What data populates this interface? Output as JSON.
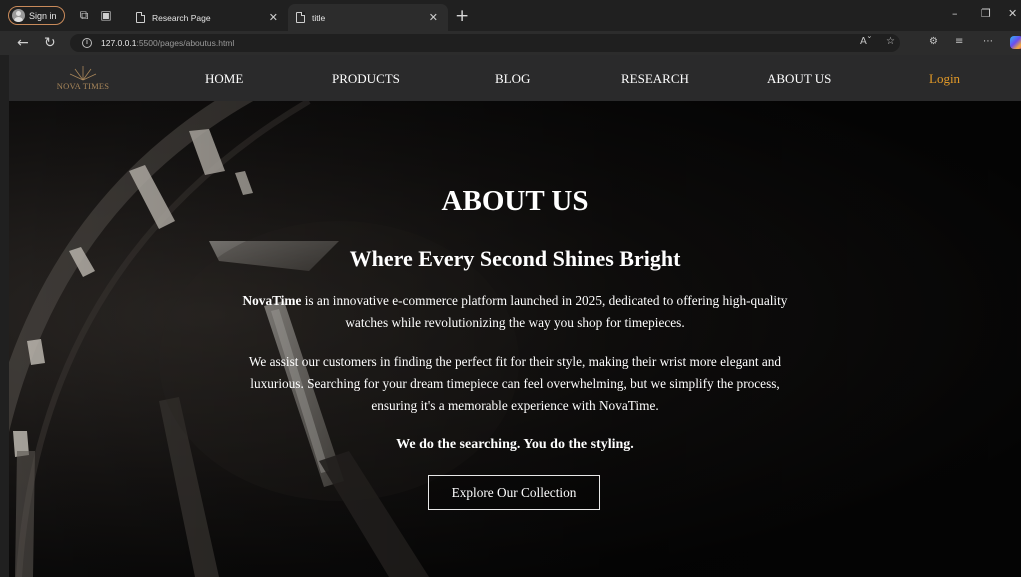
{
  "browser": {
    "signin_label": "Sign in",
    "tabs": [
      {
        "title": "Research Page"
      },
      {
        "title": "title"
      }
    ],
    "url_host": "127.0.0.1",
    "url_path": ":5500/pages/aboutus.html"
  },
  "site": {
    "logo_text": "NOVA TIMES",
    "nav": {
      "home": "HOME",
      "products": "PRODUCTS",
      "blog": "BLOG",
      "research": "RESEARCH",
      "about": "ABOUT US",
      "login": "Login"
    },
    "accent_color": "#e39a28"
  },
  "hero": {
    "title": "ABOUT US",
    "subtitle": "Where Every Second Shines Bright",
    "p1_brand": "NovaTime",
    "p1_rest": " is an innovative e-commerce platform launched in 2025, dedicated to offering high-quality watches while revolutionizing the way you shop for timepieces.",
    "p2": "We assist our customers in finding the perfect fit for their style, making their wrist more elegant and luxurious. Searching for your dream timepiece can feel overwhelming, but we simplify the process, ensuring it's a memorable experience with NovaTime.",
    "tagline": "We do the searching. You do the styling.",
    "cta": "Explore Our Collection"
  }
}
